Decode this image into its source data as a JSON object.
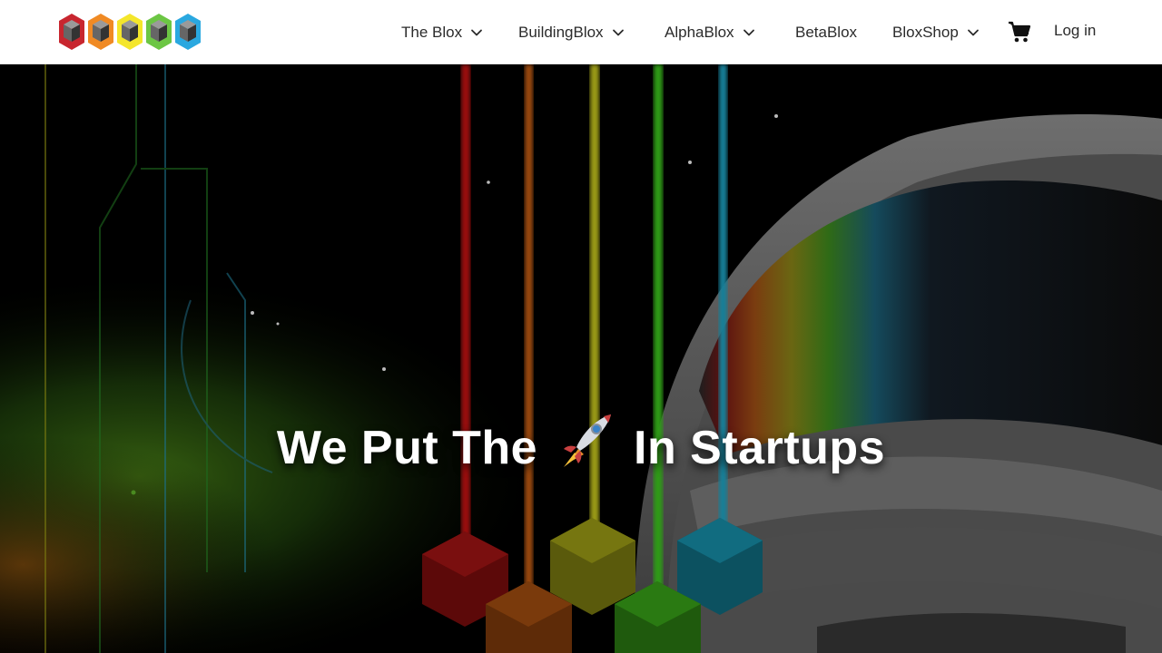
{
  "brand": {
    "logo_colors": [
      "#c8262f",
      "#f08a24",
      "#f4e62b",
      "#6cc644",
      "#2aa8e0"
    ]
  },
  "nav": {
    "items": [
      {
        "label": "The Blox",
        "has_dropdown": true
      },
      {
        "label": "BuildingBlox",
        "has_dropdown": true
      },
      {
        "label": "AlphaBlox",
        "has_dropdown": true
      },
      {
        "label": "BetaBlox",
        "has_dropdown": false
      },
      {
        "label": "BloxShop",
        "has_dropdown": true
      }
    ],
    "cart_icon": "shopping-cart-icon",
    "login_label": "Log in"
  },
  "hero": {
    "headline_before": "We Put The",
    "headline_icon": "rocket-icon",
    "headline_after": "In Startups"
  }
}
